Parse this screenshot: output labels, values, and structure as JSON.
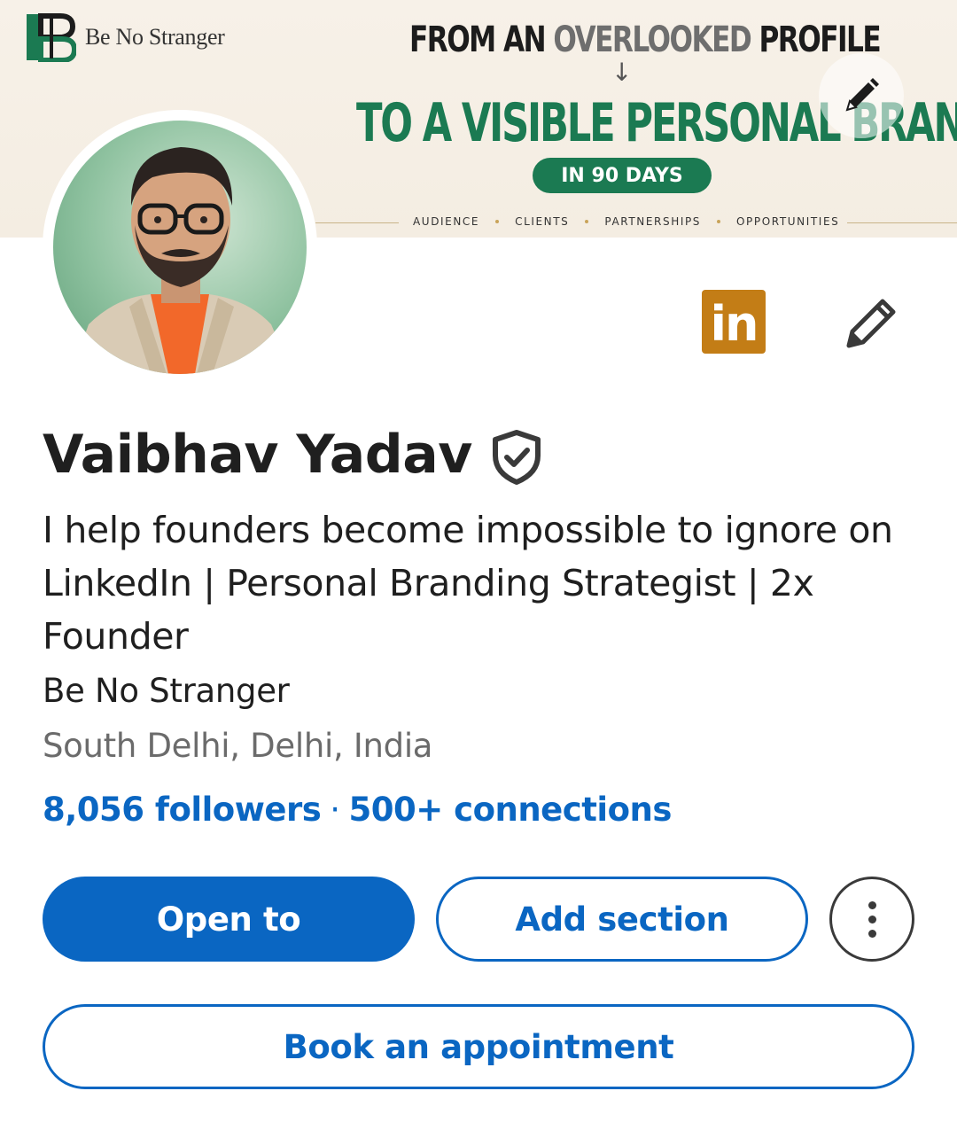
{
  "banner": {
    "brand_name": "Be No Stranger",
    "headline_line1_part1": "FROM AN ",
    "headline_line1_muted": "OVERLOOKED",
    "headline_line1_part2": " PROFILE",
    "arrow": "↓",
    "headline_line2": "TO A VISIBLE PERSONAL BRAND",
    "pill": "IN 90 DAYS",
    "tags": [
      "AUDIENCE",
      "CLIENTS",
      "PARTNERSHIPS",
      "OPPORTUNITIES"
    ],
    "accent_green": "#1b7a52"
  },
  "profile": {
    "name": "Vaibhav Yadav",
    "headline": "I help founders become impossible to ignore on LinkedIn | Personal Branding Strategist | 2x Founder",
    "company": "Be No Stranger",
    "location": "South Delhi, Delhi, India",
    "followers": "8,056 followers",
    "separator": "·",
    "connections": "500+ connections"
  },
  "badges": {
    "linkedin_label": "in",
    "linkedin_color": "#c37d16"
  },
  "actions": {
    "open_to": "Open to",
    "add_section": "Add section",
    "book_appointment": "Book an appointment"
  },
  "colors": {
    "primary": "#0a66c2",
    "text": "#1f1f1f",
    "muted": "#6b6b6b"
  }
}
